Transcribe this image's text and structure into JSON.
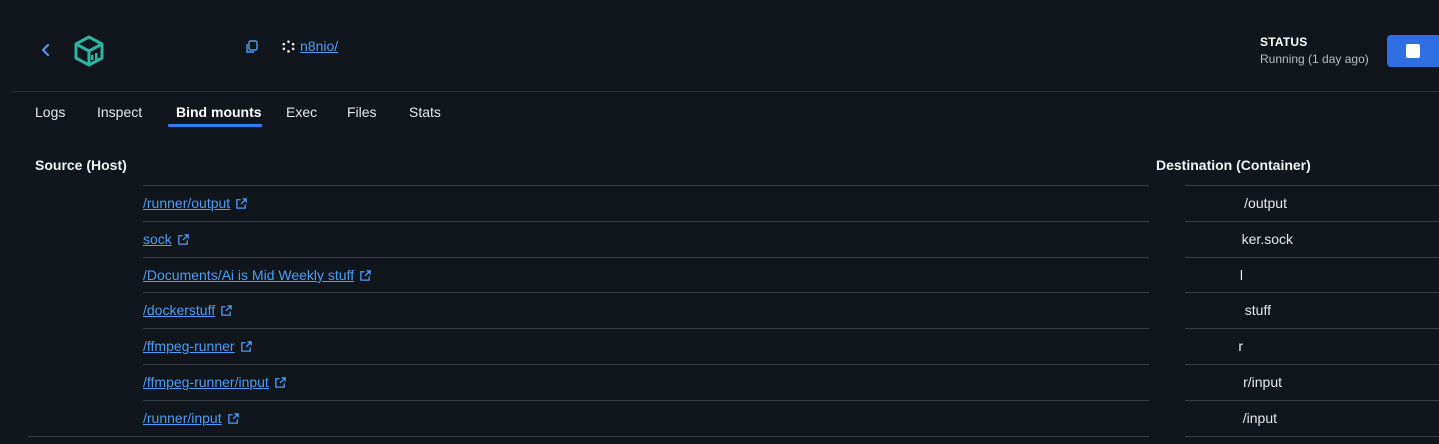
{
  "header": {
    "image_link": "n8nio/",
    "status_label": "STATUS",
    "status_value": "Running (1 day ago)"
  },
  "tabs": [
    {
      "label": "Logs",
      "active": false
    },
    {
      "label": "Inspect",
      "active": false
    },
    {
      "label": "Bind mounts",
      "active": true
    },
    {
      "label": "Exec",
      "active": false
    },
    {
      "label": "Files",
      "active": false
    },
    {
      "label": "Stats",
      "active": false
    }
  ],
  "table": {
    "headers": {
      "source": "Source (Host)",
      "destination": "Destination (Container)"
    },
    "rows": [
      {
        "source": "/runner/output",
        "destination": "/output"
      },
      {
        "source": "sock",
        "destination": "ker.sock"
      },
      {
        "source": "/Documents/Ai is Mid Weekly stuff",
        "destination": "l"
      },
      {
        "source": "/dockerstuff",
        "destination": "stuff"
      },
      {
        "source": "/ffmpeg-runner",
        "destination": "r"
      },
      {
        "source": "/ffmpeg-runner/input",
        "destination": "r/input"
      },
      {
        "source": "/runner/input",
        "destination": "/input"
      }
    ]
  },
  "colors": {
    "background": "#11151c",
    "link": "#4d9cf7",
    "accent": "#2f7ff3",
    "stop_button": "#2f6fe3"
  },
  "icons": {
    "back": "chevron-left-icon",
    "logo": "container-cube-icon",
    "copy": "copy-icon",
    "image": "image-hexagon-icon",
    "stop": "stop-square-icon",
    "external": "external-link-icon"
  }
}
